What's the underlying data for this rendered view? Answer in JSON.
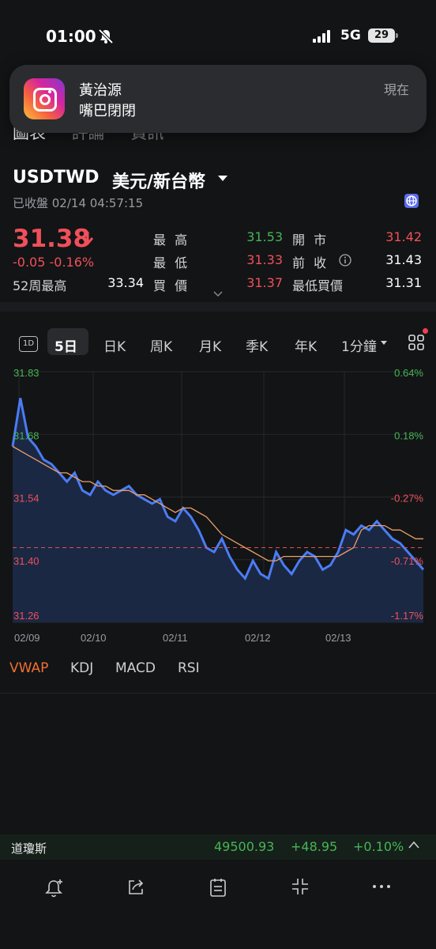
{
  "status_bar": {
    "time": "01:00",
    "network": "5G",
    "battery": "29"
  },
  "notification": {
    "app": "instagram",
    "title": "黃治源",
    "body": "嘴巴閉閉",
    "time": "現在"
  },
  "tabs": [
    "圖表",
    "評論",
    "資訊"
  ],
  "symbol": {
    "code": "USDTWD",
    "name": "美元/新台幣",
    "status": "已收盤 02/14 04:57:15"
  },
  "quote": {
    "last": "31.38",
    "change": "-0.05 -0.16%",
    "high_label": "最 高",
    "high": "31.53",
    "low_label": "最 低",
    "low": "31.33",
    "bid_label": "買 價",
    "bid": "31.37",
    "open_label": "開 市",
    "open": "31.42",
    "prev_label": "前 收",
    "prev": "31.43",
    "minbid_label": "最低買價",
    "minbid": "31.31",
    "w52_label": "52周最高",
    "w52": "33.34"
  },
  "periods": [
    "1D",
    "5日",
    "日K",
    "周K",
    "月K",
    "季K",
    "年K",
    "1分鐘"
  ],
  "indicators": [
    "VWAP",
    "KDJ",
    "MACD",
    "RSI"
  ],
  "colors": {
    "up": "#45b555",
    "down": "#f0505a",
    "price_line": "#4a7cf5",
    "vwap": "#e8a06a"
  },
  "chart_data": {
    "type": "area",
    "x_ticks": [
      "02/09",
      "02/10",
      "02/11",
      "02/12",
      "02/13"
    ],
    "y_ticks": [
      "31.83",
      "31.68",
      "31.54",
      "31.40",
      "31.26"
    ],
    "pct_ticks": [
      "0.64%",
      "0.18%",
      "-0.27%",
      "-0.71%",
      "-1.17%"
    ],
    "ylim": [
      31.26,
      31.83
    ],
    "prev_close": 31.43,
    "series": [
      {
        "name": "price",
        "values": [
          31.66,
          31.77,
          31.68,
          31.66,
          31.63,
          31.62,
          31.6,
          31.58,
          31.6,
          31.56,
          31.55,
          31.58,
          31.56,
          31.55,
          31.56,
          31.57,
          31.55,
          31.54,
          31.53,
          31.54,
          31.5,
          31.49,
          31.52,
          31.5,
          31.47,
          31.43,
          31.42,
          31.45,
          31.41,
          31.38,
          31.36,
          31.4,
          31.37,
          31.36,
          31.42,
          31.39,
          31.37,
          31.4,
          31.42,
          31.41,
          31.38,
          31.39,
          31.42,
          31.47,
          31.46,
          31.48,
          31.47,
          31.49,
          31.47,
          31.45,
          31.44,
          31.42,
          31.4,
          31.38
        ]
      },
      {
        "name": "VWAP",
        "values": [
          31.66,
          31.65,
          31.64,
          31.63,
          31.62,
          31.61,
          31.6,
          31.6,
          31.59,
          31.58,
          31.58,
          31.57,
          31.57,
          31.56,
          31.56,
          31.56,
          31.55,
          31.55,
          31.54,
          31.53,
          31.52,
          31.51,
          31.52,
          31.52,
          31.51,
          31.5,
          31.48,
          31.46,
          31.45,
          31.44,
          31.43,
          31.42,
          31.41,
          31.4,
          31.4,
          31.41,
          31.41,
          31.41,
          31.41,
          31.41,
          31.41,
          31.41,
          31.41,
          31.42,
          31.43,
          31.47,
          31.48,
          31.48,
          31.48,
          31.47,
          31.47,
          31.46,
          31.45,
          31.45
        ]
      }
    ]
  }
}
